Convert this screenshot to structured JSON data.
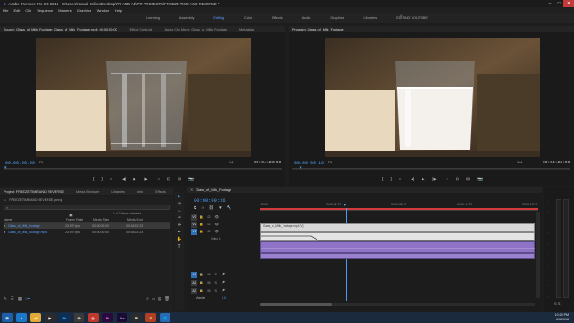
{
  "window": {
    "title": "Adobe Premiere Pro CC 2018 - C:\\Users\\Kamal-Online\\Desktop\\PR AND AE\\PR PROJECTS\\FREEZE TIME AND REVERSE *"
  },
  "menu": [
    "File",
    "Edit",
    "Clip",
    "Sequence",
    "Markers",
    "Graphics",
    "Window",
    "Help"
  ],
  "workspaces": {
    "items": [
      "Learning",
      "Assembly",
      "Editing",
      "Color",
      "Effects",
      "Audio",
      "Graphics",
      "Libraries",
      "EDITING YOUTUBE"
    ],
    "active": "Editing",
    "more": "»"
  },
  "source": {
    "tabs": [
      "Source: Glass_of_Milk_Footage: Glass_of_Milk_Footage.mp4: 00:00:00:00",
      "Effect Controls",
      "Audio Clip Mixer: Glass_of_Milk_Footage",
      "Metadata"
    ],
    "timecode": "00:00:00:00",
    "fit": "Fit",
    "resolution": "1/4",
    "duration": "00:04:23:00"
  },
  "program": {
    "tabs": [
      "Program: Glass_of_Milk_Footage"
    ],
    "timecode": "00:00:09:16",
    "fit": "Fit",
    "resolution": "1/4",
    "duration": "00:04:23:00"
  },
  "transport": [
    "{",
    "}",
    "⇤",
    "◀|",
    "▶",
    "|▶",
    "⇥",
    "⊡",
    "⊞",
    "📷"
  ],
  "project": {
    "tabs": [
      "Project: FREEZE TIME AND REVERSE",
      "Media Browser",
      "Libraries",
      "Info",
      "Effects"
    ],
    "file": "FREEZE TIME AND REVERSE.prproj",
    "selection": "1 of 2 items selected",
    "columns": [
      "Name",
      "Frame Rate",
      "Media Start",
      "Media End"
    ],
    "rows": [
      {
        "name": "Glass_of_Milk_Footage",
        "rate": "23.976 fps",
        "start": "00:00:00:00",
        "end": "00:04:22:23"
      },
      {
        "name": "Glass_of_Milk_Footage.mp4",
        "rate": "23.976 fps",
        "start": "00:00:00:00",
        "end": "00:04:22:23"
      }
    ]
  },
  "timeline": {
    "tab": "Glass_of_Milk_Footage",
    "timecode": "00:00:09:16",
    "ruler": [
      ":00:00",
      "00:00:04:23",
      "00:00:09:23",
      "00:00:14:23",
      "00:00:19:23"
    ],
    "clip_label": "Glass_of_Milk_Footage.mp4 [V]",
    "tracks_video": [
      "V3",
      "V2",
      "V1"
    ],
    "tracks_audio": [
      "A1",
      "A2",
      "A3"
    ],
    "v1_label": "Video 1",
    "master": "Master",
    "master_value": "0.0"
  },
  "taskbar": {
    "apps": [
      "⊞",
      "e",
      "📁",
      "▶",
      "Ps",
      "⊚",
      "◎",
      "Pr",
      "Ae",
      "✉",
      "⊙",
      "🌐"
    ],
    "time": "10:29 PM",
    "date": "6/5/2018"
  },
  "colors": {
    "accent": "#4c9cf1",
    "audio_clip": "#8f73c6",
    "video_clip": "#c8c8c8",
    "track_target": "#2f6fb3"
  }
}
